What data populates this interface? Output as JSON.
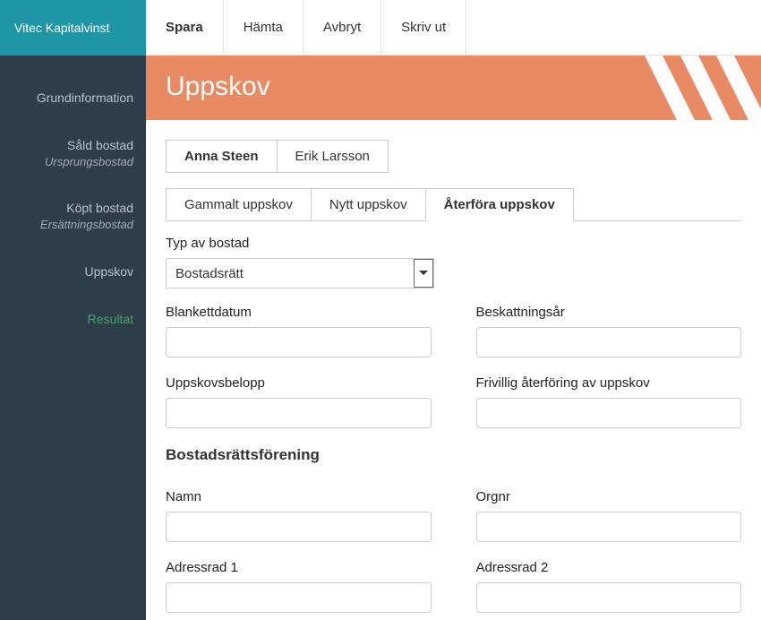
{
  "brand": "Vitec Kapitalvinst",
  "toolbar": {
    "save": "Spara",
    "fetch": "Hämta",
    "cancel": "Avbryt",
    "print": "Skriv ut"
  },
  "page_title": "Uppskov",
  "sidebar": {
    "items": [
      {
        "label": "Grundinformation",
        "sub": ""
      },
      {
        "label": "Såld bostad",
        "sub": "Ursprungsbostad"
      },
      {
        "label": "Köpt bostad",
        "sub": "Ersättningsbostad"
      },
      {
        "label": "Uppskov",
        "sub": ""
      },
      {
        "label": "Resultat",
        "sub": ""
      }
    ]
  },
  "person_tabs": [
    "Anna Steen",
    "Erik Larsson"
  ],
  "uppskov_tabs": [
    "Gammalt uppskov",
    "Nytt uppskov",
    "Återföra uppskov"
  ],
  "labels": {
    "typ_av_bostad": "Typ av bostad",
    "blankettdatum": "Blankettdatum",
    "beskattningsar": "Beskattningsår",
    "uppskovsbelopp": "Uppskovsbelopp",
    "frivillig": "Frivillig återföring av uppskov",
    "section": "Bostadsrättsförening",
    "namn": "Namn",
    "orgnr": "Orgnr",
    "adress1": "Adressrad 1",
    "adress2": "Adressrad 2"
  },
  "select_value": "Bostadsrätt",
  "values": {
    "blankettdatum": "",
    "beskattningsar": "",
    "uppskovsbelopp": "",
    "frivillig": "",
    "namn": "",
    "orgnr": "",
    "adress1": "",
    "adress2": ""
  }
}
